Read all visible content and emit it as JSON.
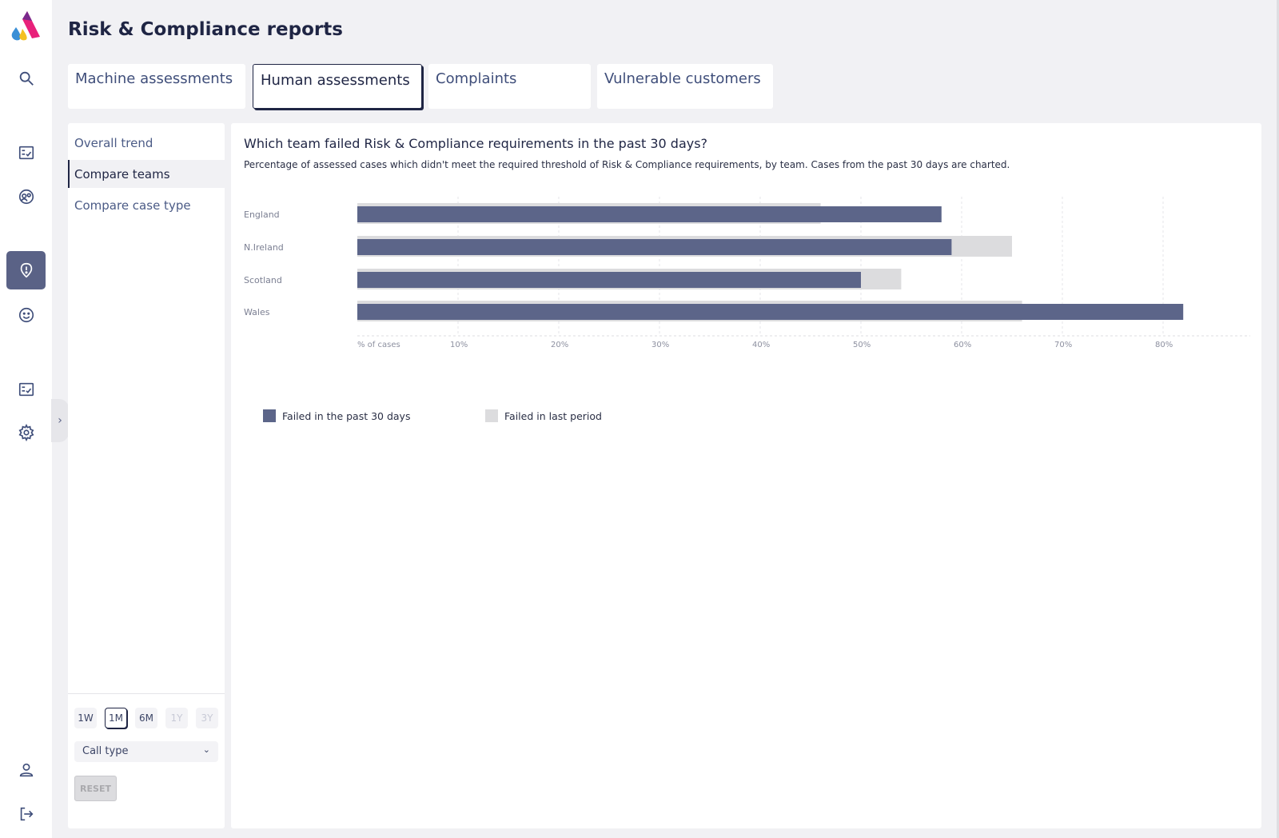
{
  "page": {
    "title": "Risk & Compliance reports"
  },
  "rail": {
    "icons": [
      "search-icon",
      "checklist-icon",
      "agents-icon",
      "risk-shield-icon",
      "smiley-icon",
      "checklist-icon",
      "gear-icon",
      "user-icon",
      "logout-icon"
    ],
    "active": "risk-shield-icon",
    "expand_glyph": "›"
  },
  "tabs": [
    {
      "label": "Machine assessments",
      "active": false
    },
    {
      "label": "Human assessments",
      "active": true
    },
    {
      "label": "Complaints",
      "active": false
    },
    {
      "label": "Vulnerable customers",
      "active": false
    }
  ],
  "subnav": [
    {
      "label": "Overall trend",
      "active": false
    },
    {
      "label": "Compare teams",
      "active": true
    },
    {
      "label": "Compare case type",
      "active": false
    }
  ],
  "filters": {
    "ranges": [
      {
        "label": "1W",
        "state": "normal"
      },
      {
        "label": "1M",
        "state": "active"
      },
      {
        "label": "6M",
        "state": "normal"
      },
      {
        "label": "1Y",
        "state": "disabled"
      },
      {
        "label": "3Y",
        "state": "disabled"
      }
    ],
    "select_value": "Call type",
    "reset_label": "RESET"
  },
  "card": {
    "title": "Which team failed Risk & Compliance requirements in the past 30 days?",
    "subtitle": "Percentage of assessed cases which didn't meet the required threshold of Risk & Compliance requirements, by team. Cases from the past 30 days are charted."
  },
  "colors": {
    "current": "#5c6589",
    "previous": "#dcdcde",
    "accent": "#1f2544"
  },
  "chart_data": {
    "type": "bar",
    "orientation": "horizontal",
    "categories": [
      "England",
      "N.Ireland",
      "Scotland",
      "Wales"
    ],
    "series": [
      {
        "name": "Failed in the past 30 days",
        "values": [
          58,
          59,
          50,
          82
        ]
      },
      {
        "name": "Failed in last period",
        "values": [
          46,
          65,
          54,
          66
        ]
      }
    ],
    "x_axis_label": "% of cases",
    "x_ticks": [
      "10%",
      "20%",
      "30%",
      "40%",
      "50%",
      "60%",
      "70%",
      "80%"
    ],
    "xlim": [
      0,
      88
    ],
    "grid": true,
    "legend_position": "bottom-left"
  }
}
